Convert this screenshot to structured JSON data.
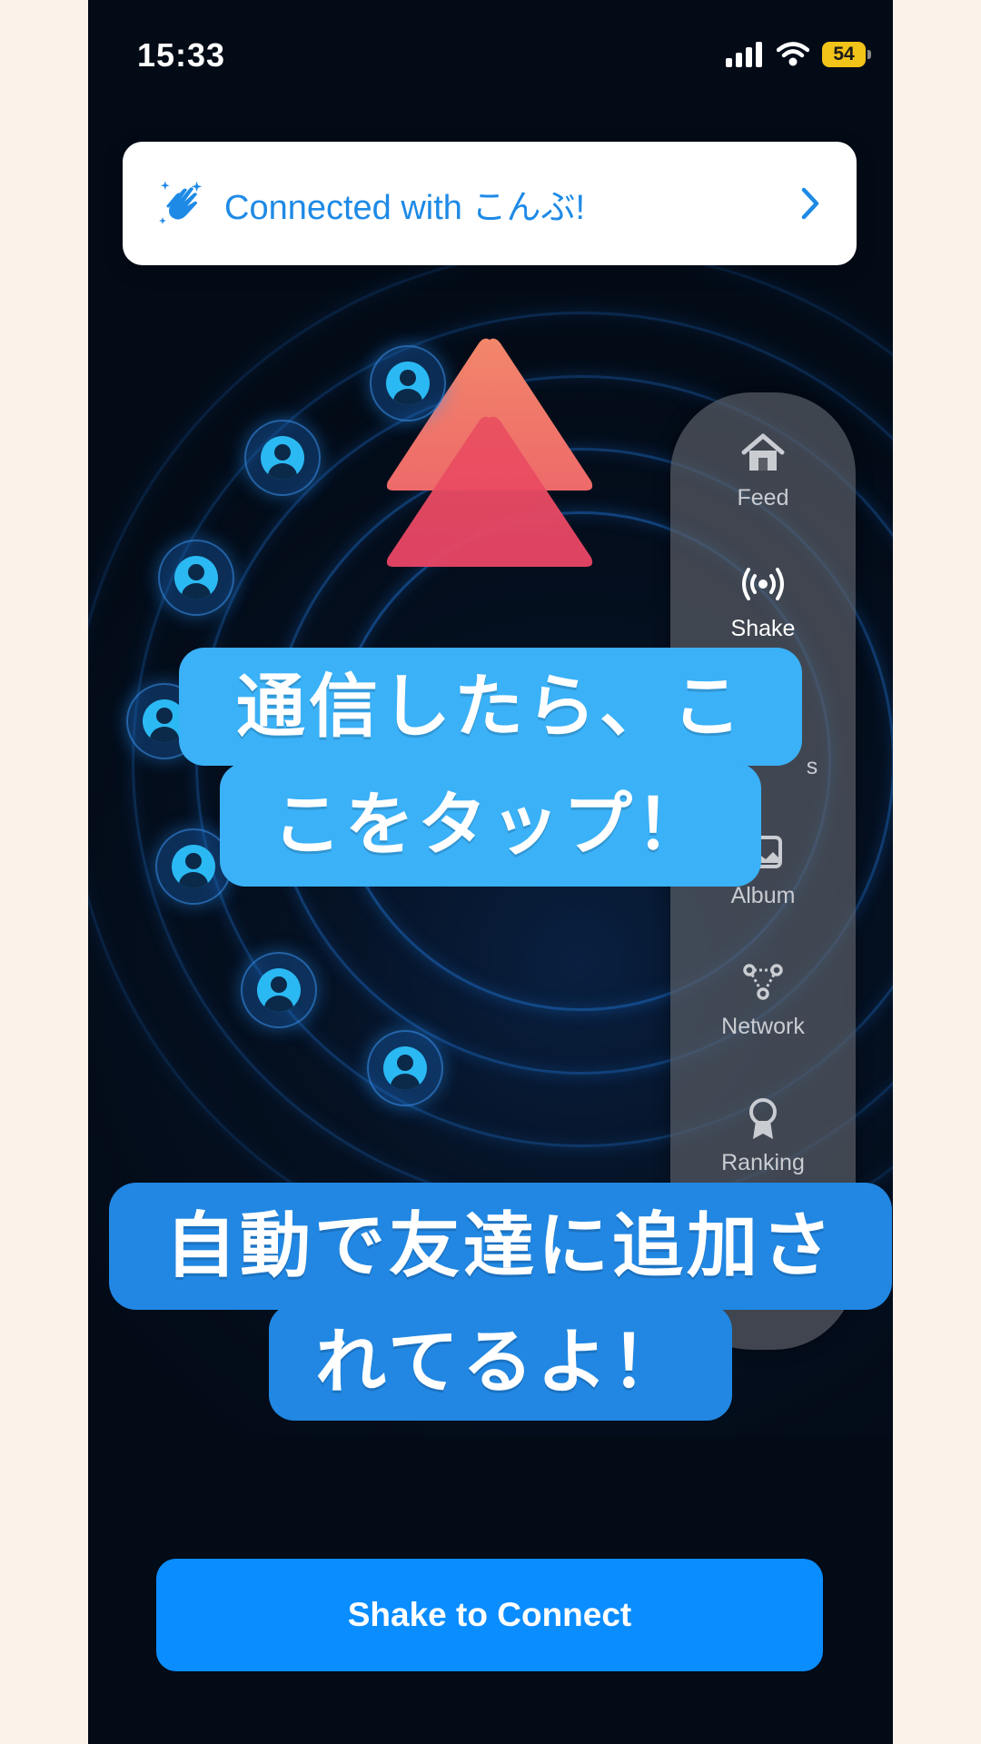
{
  "status_bar": {
    "time": "15:33",
    "battery": "54"
  },
  "banner": {
    "text": "Connected with こんぶ!"
  },
  "nav": {
    "items": [
      {
        "label": "Feed",
        "icon": "home-icon"
      },
      {
        "label": "Shake",
        "icon": "broadcast-icon",
        "active": true
      },
      {
        "label": "s",
        "icon": "friends-icon"
      },
      {
        "label": "Album",
        "icon": "photo-icon"
      },
      {
        "label": "Network",
        "icon": "network-icon"
      },
      {
        "label": "Ranking",
        "icon": "award-icon"
      }
    ]
  },
  "captions": {
    "line1a": "通信したら、こ",
    "line1b": "こをタップ！",
    "line2a": "自動で友達に追加さ",
    "line2b": "れてるよ！"
  },
  "button": {
    "label": "Shake to Connect"
  },
  "colors": {
    "accent": "#0a8dff",
    "banner_text": "#1e8ae6",
    "caption_light": "#3bb1f7",
    "caption_dark": "#2187e2",
    "arrow_top": "#f27a6a",
    "arrow_bottom": "#ea4763"
  }
}
